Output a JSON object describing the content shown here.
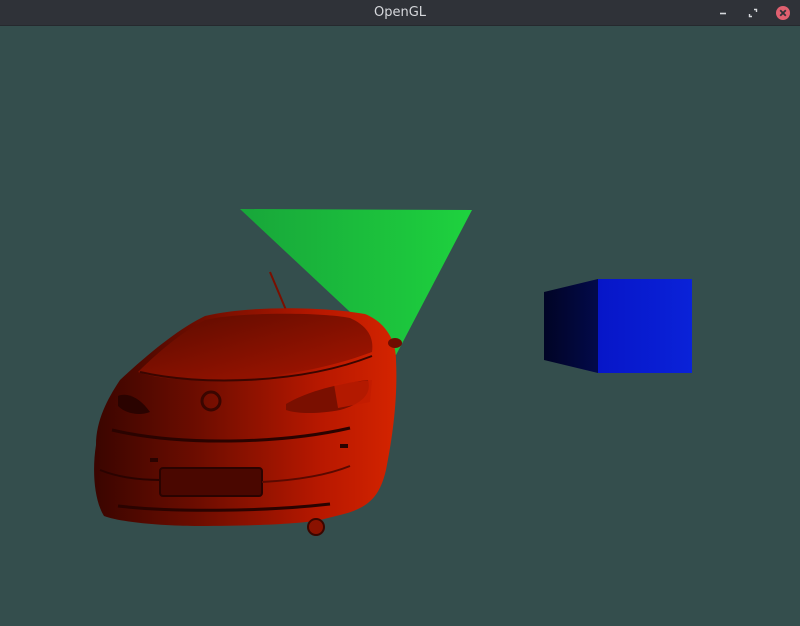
{
  "window": {
    "title": "OpenGL",
    "background_color": "#344e4d",
    "controls": [
      {
        "name": "minimize",
        "icon": "minimize-icon"
      },
      {
        "name": "maximize",
        "icon": "maximize-icon"
      },
      {
        "name": "close",
        "icon": "close-icon",
        "color": "#e06070"
      }
    ]
  },
  "scene": {
    "objects": [
      {
        "name": "car-model",
        "color": "#cc1a00"
      },
      {
        "name": "green-triangle",
        "color": "#1ec83c"
      },
      {
        "name": "blue-cube",
        "color": "#0a1ed6"
      }
    ]
  }
}
